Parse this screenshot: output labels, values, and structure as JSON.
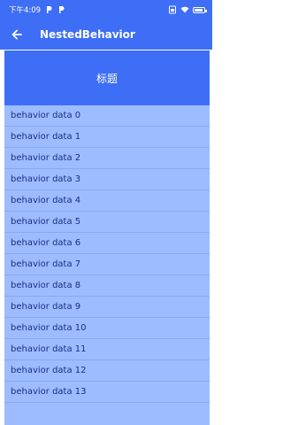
{
  "status_bar": {
    "time": "下午4:09",
    "icons": [
      "p-icon",
      "p-icon",
      "sim-icon",
      "wifi-icon",
      "battery-icon"
    ]
  },
  "app_bar": {
    "title": "NestedBehavior",
    "back_icon": "arrow-back-icon"
  },
  "header": {
    "text": "标题"
  },
  "list": {
    "items": [
      "behavior data 0",
      "behavior data 1",
      "behavior data 2",
      "behavior data 3",
      "behavior data 4",
      "behavior data 5",
      "behavior data 6",
      "behavior data 7",
      "behavior data 8",
      "behavior data 9",
      "behavior data 10",
      "behavior data 11",
      "behavior data 12",
      "behavior data 13"
    ]
  },
  "colors": {
    "primary": "#3d6ef5",
    "list_background": "#9dbcff",
    "list_text": "#1a2e85"
  }
}
